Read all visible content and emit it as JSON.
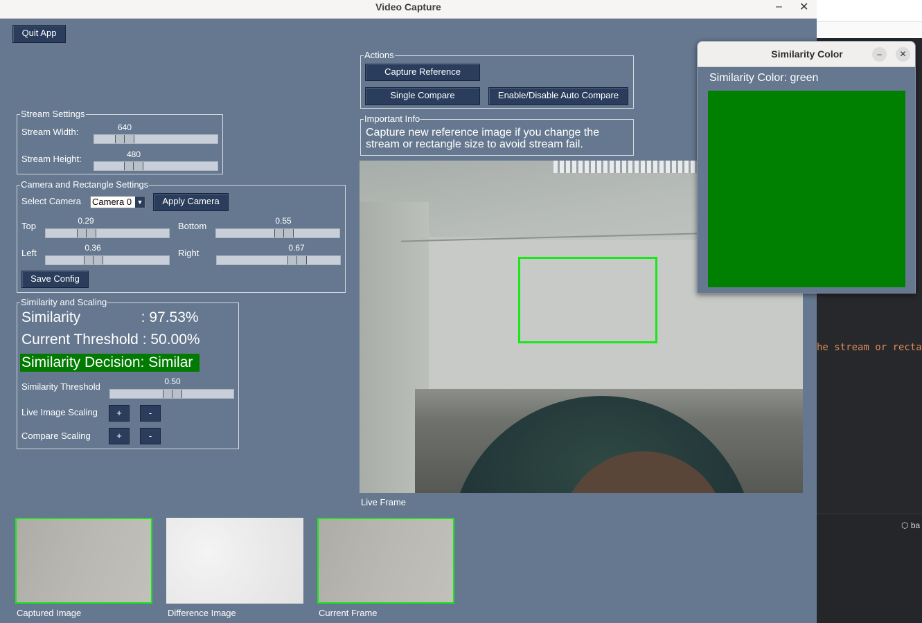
{
  "window": {
    "title": "Video Capture",
    "minimize": "–",
    "close": "✕"
  },
  "toolbar": {
    "quit_label": "Quit App"
  },
  "actions": {
    "group_label": "Actions",
    "capture_reference": "Capture Reference",
    "single_compare": "Single Compare",
    "auto_compare": "Enable/Disable Auto Compare"
  },
  "info": {
    "group_label": "Important Info",
    "text": "Capture new reference image if you change the stream or rectangle size to avoid stream fail."
  },
  "stream": {
    "group_label": "Stream Settings",
    "width_label": "Stream Width:",
    "width_value": "640",
    "width_fraction": 0.2,
    "height_label": "Stream Height:",
    "height_value": "480",
    "height_fraction": 0.3
  },
  "camera": {
    "group_label": "Camera and Rectangle Settings",
    "select_label": "Select Camera",
    "select_value": "Camera 0",
    "apply_label": "Apply Camera",
    "top_label": "Top",
    "top_value": "0.29",
    "bottom_label": "Bottom",
    "bottom_value": "0.55",
    "left_label": "Left",
    "left_value": "0.36",
    "right_label": "Right",
    "right_value": "0.67",
    "save_label": "Save Config"
  },
  "similarity": {
    "group_label": "Similarity and Scaling",
    "similarity_line": "Similarity               : 97.53%",
    "threshold_line": "Current Threshold : 50.00%",
    "decision": "Similarity Decision: Similar",
    "threshold_label": "Similarity Threshold",
    "threshold_value": "0.50",
    "live_scaling_label": "Live Image Scaling",
    "compare_scaling_label": "Compare Scaling",
    "plus": "+",
    "minus": "-"
  },
  "frames": {
    "live_caption": "Live Frame",
    "captured_caption": "Captured Image",
    "difference_caption": "Difference Image",
    "current_caption": "Current Frame"
  },
  "similarity_window": {
    "title": "Similarity Color",
    "label": "Similarity Color: green",
    "color": "#008000",
    "minimize": "–",
    "close": "✕"
  },
  "background": {
    "code_snippet": "he stream or recta",
    "file_label": "ba"
  },
  "colors": {
    "window_bg": "#65788f",
    "button_bg": "#2a3d5c",
    "roi_border": "#18e818",
    "decision_bg": "#007a00"
  }
}
